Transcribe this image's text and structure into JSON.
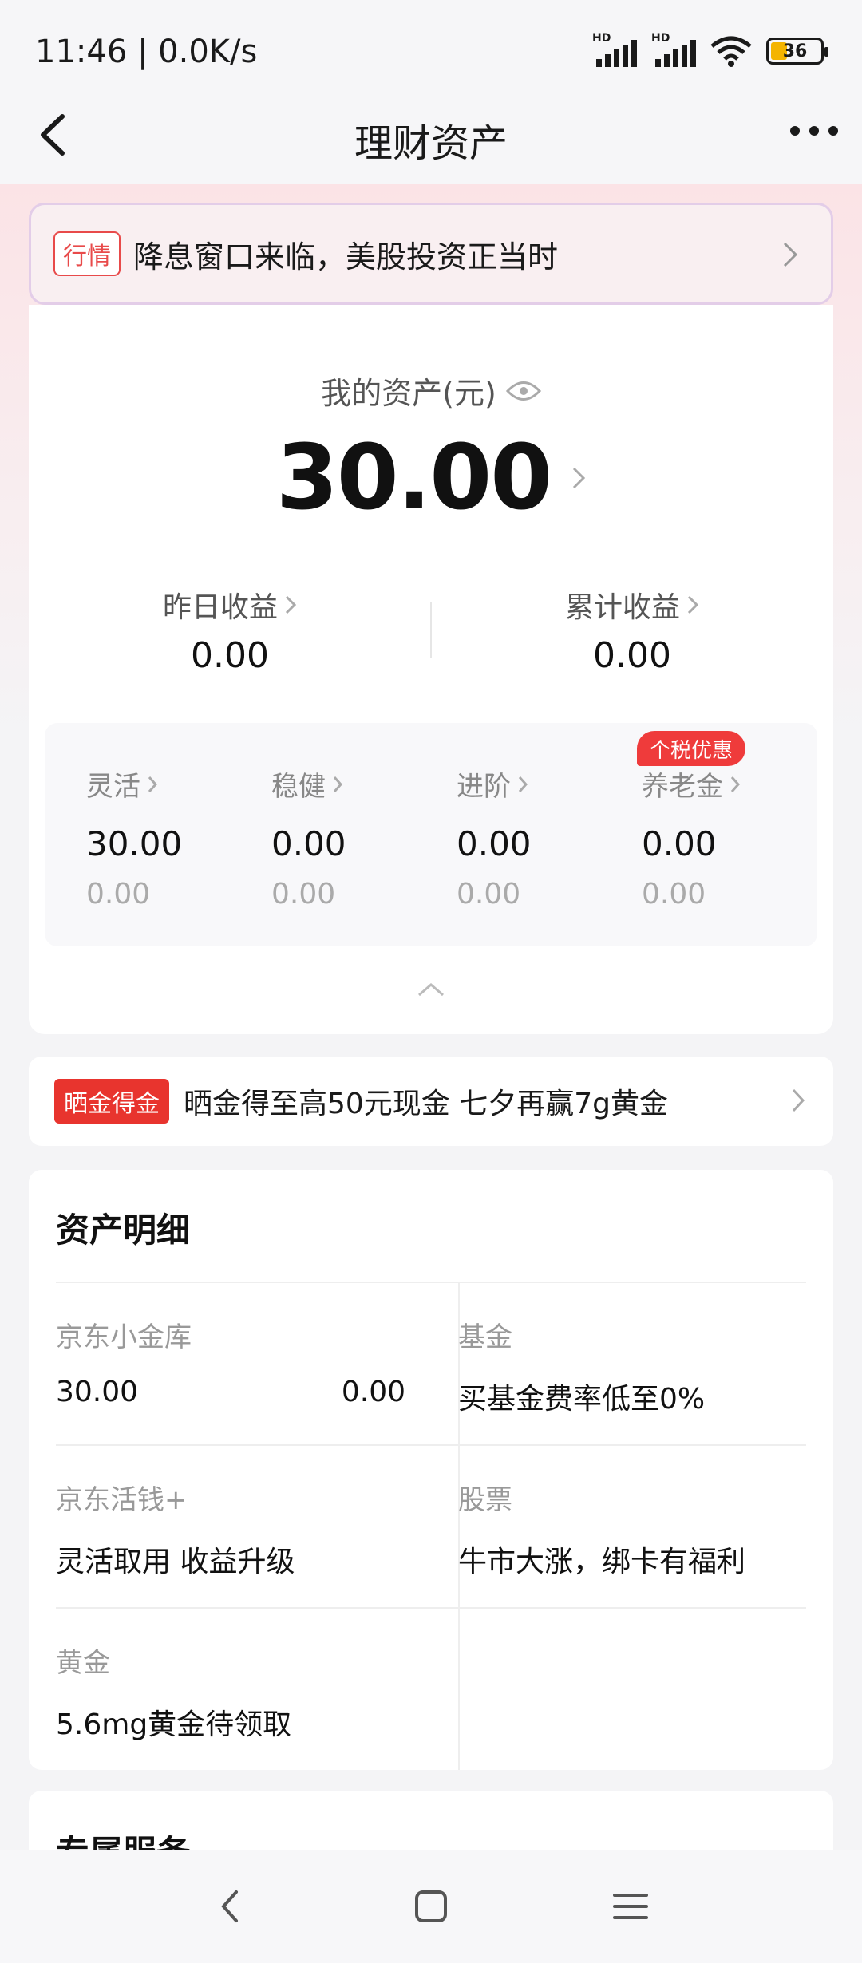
{
  "status_bar": {
    "time": "11:46 | 0.0K/s",
    "signal_1_label": "HD",
    "signal_2_label": "HD",
    "battery": "36"
  },
  "nav": {
    "title": "理财资产"
  },
  "news": {
    "tag": "行情",
    "text": "降息窗口来临，美股投资正当时"
  },
  "assets": {
    "label": "我的资产(元)",
    "total": "30.00",
    "yesterday_label": "昨日收益",
    "yesterday_value": "0.00",
    "cumulative_label": "累计收益",
    "cumulative_value": "0.00"
  },
  "categories": [
    {
      "label": "灵活",
      "value": "30.00",
      "sub": "0.00"
    },
    {
      "label": "稳健",
      "value": "0.00",
      "sub": "0.00"
    },
    {
      "label": "进阶",
      "value": "0.00",
      "sub": "0.00"
    },
    {
      "label": "养老金",
      "value": "0.00",
      "sub": "0.00",
      "badge": "个税优惠"
    }
  ],
  "promo": {
    "tag": "晒金得金",
    "text": "晒金得至高50元现金 七夕再赢7g黄金"
  },
  "detail": {
    "title": "资产明细",
    "cells": [
      {
        "label": "京东小金库",
        "value": "30.00",
        "value2": "0.00"
      },
      {
        "label": "基金",
        "value": "买基金费率低至0%"
      },
      {
        "label": "京东活钱+",
        "value": "灵活取用 收益升级"
      },
      {
        "label": "股票",
        "value": "牛市大涨，绑卡有福利"
      },
      {
        "label": "黄金",
        "value": "5.6mg黄金待领取"
      }
    ]
  },
  "services": {
    "title": "专属服务"
  },
  "colors": {
    "accent_red": "#e8342e",
    "badge_red": "#ef3b3b",
    "battery_fill": "#f4b400"
  },
  "icons": [
    "back-arrow-icon",
    "more-dots-icon",
    "eye-icon",
    "chevron-right-icon",
    "chevron-up-icon",
    "wifi-icon",
    "battery-icon",
    "nav-back-icon",
    "nav-home-icon",
    "nav-menu-icon"
  ]
}
